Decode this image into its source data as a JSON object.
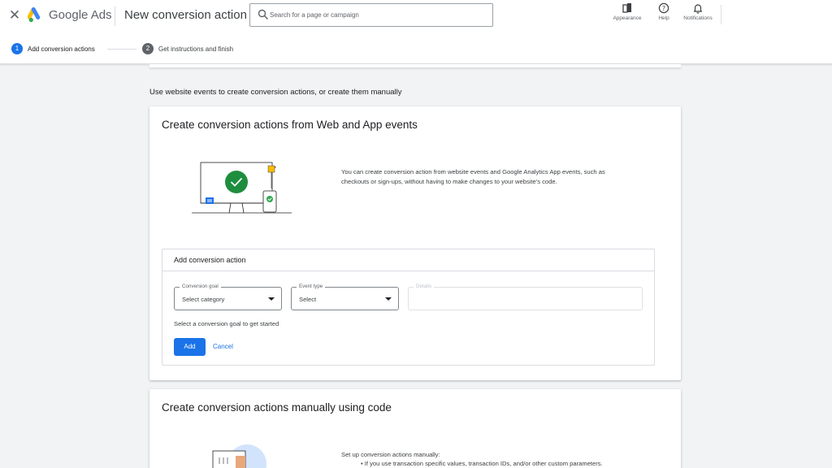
{
  "header": {
    "close_icon": "close-icon",
    "product_name": "Google Ads",
    "page_title": "New conversion action",
    "search": {
      "placeholder": "Search for a page or campaign"
    },
    "tools": [
      {
        "label": "Appearance",
        "icon": "appearance-icon"
      },
      {
        "label": "Help",
        "icon": "help-icon"
      },
      {
        "label": "Notifications",
        "icon": "bell-icon"
      }
    ]
  },
  "stepper": {
    "steps": [
      {
        "number": "1",
        "label": "Add conversion actions",
        "active": true
      },
      {
        "number": "2",
        "label": "Get instructions and finish",
        "active": false
      }
    ]
  },
  "main": {
    "intro": "Use website events to create conversion actions, or create them manually",
    "events_card": {
      "title": "Create conversion actions from Web and App events",
      "description": "You can create conversion action from website events and Google Analytics App events, such as checkouts or sign-ups, without having to make changes to your website's code.",
      "panel": {
        "title": "Add conversion action",
        "fields": {
          "goal": {
            "label": "Conversion goal",
            "value": "Select category"
          },
          "event": {
            "label": "Event type",
            "value": "Select"
          },
          "details": {
            "label": "Details",
            "value": ""
          }
        },
        "hint": "Select a conversion goal to get started",
        "add_label": "Add",
        "cancel_label": "Cancel"
      }
    },
    "manual_card": {
      "title": "Create conversion actions manually using code",
      "description": "Set up conversion actions manually:",
      "bullet": "If you use transaction specific values, transaction IDs, and/or other custom parameters."
    }
  },
  "colors": {
    "primary": "#1a73e8",
    "success": "#34a853",
    "accent_yellow": "#fbbc04",
    "background": "#f1f3f4"
  }
}
